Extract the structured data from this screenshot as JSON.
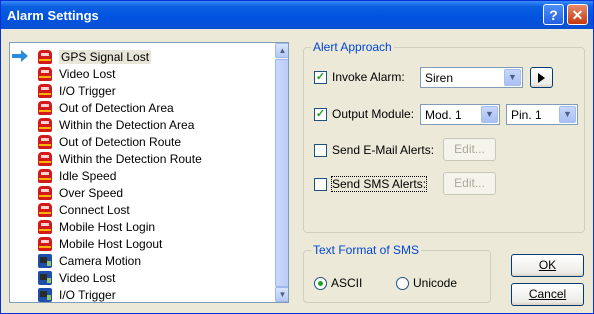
{
  "window": {
    "title": "Alarm Settings",
    "help_label": "?",
    "close_label": "✕"
  },
  "alarm_list": {
    "items": [
      {
        "label": "GPS Signal Lost",
        "icon": "alarm-icon",
        "selected": true
      },
      {
        "label": "Video Lost",
        "icon": "alarm-icon"
      },
      {
        "label": "I/O Trigger",
        "icon": "alarm-icon"
      },
      {
        "label": "Out of Detection Area",
        "icon": "alarm-icon"
      },
      {
        "label": "Within the Detection Area",
        "icon": "alarm-icon"
      },
      {
        "label": "Out of Detection Route",
        "icon": "alarm-icon"
      },
      {
        "label": "Within the Detection Route",
        "icon": "alarm-icon"
      },
      {
        "label": "Idle Speed",
        "icon": "alarm-icon"
      },
      {
        "label": "Over Speed",
        "icon": "alarm-icon"
      },
      {
        "label": "Connect Lost",
        "icon": "alarm-icon"
      },
      {
        "label": "Mobile Host Login",
        "icon": "alarm-icon"
      },
      {
        "label": "Mobile Host Logout",
        "icon": "alarm-icon"
      },
      {
        "label": "Camera Motion",
        "icon": "camera-icon"
      },
      {
        "label": "Video Lost",
        "icon": "camera-icon"
      },
      {
        "label": "I/O Trigger",
        "icon": "camera-icon"
      }
    ]
  },
  "alert_approach": {
    "group_label": "Alert Approach",
    "invoke_alarm": {
      "label": "Invoke Alarm:",
      "checked": true,
      "value": "Siren"
    },
    "output_module": {
      "label": "Output Module:",
      "checked": true,
      "module": "Mod. 1",
      "pin": "Pin. 1"
    },
    "send_email": {
      "label": "Send E-Mail Alerts:",
      "checked": false,
      "edit_label": "Edit..."
    },
    "send_sms": {
      "label": "Send SMS Alerts:",
      "checked": false,
      "edit_label": "Edit..."
    }
  },
  "sms_format": {
    "group_label": "Text Format of SMS",
    "options": [
      {
        "label": "ASCII",
        "selected": true
      },
      {
        "label": "Unicode",
        "selected": false
      }
    ]
  },
  "buttons": {
    "ok": "OK",
    "cancel": "Cancel"
  },
  "colors": {
    "title_bar": "#0053e1",
    "group_label": "#0046d5",
    "check_mark": "#21a121",
    "alarm_icon": "#d21a1a",
    "camera_icon": "#1e4fa8"
  }
}
